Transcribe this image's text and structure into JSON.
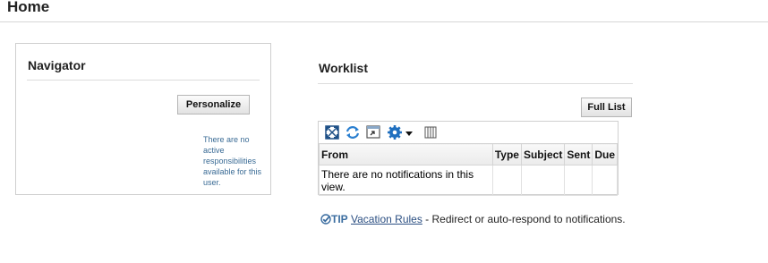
{
  "page": {
    "title": "Home"
  },
  "navigator": {
    "title": "Navigator",
    "personalize_label": "Personalize",
    "empty_message": "There are no active responsibilities available for this user."
  },
  "worklist": {
    "title": "Worklist",
    "full_list_label": "Full List",
    "toolbar_icons": [
      "expand-icon",
      "refresh-icon",
      "detach-icon",
      "settings-icon",
      "dropdown-arrow-icon",
      "columns-icon"
    ],
    "columns": [
      "From",
      "Type",
      "Subject",
      "Sent",
      "Due"
    ],
    "empty_message": "There are no notifications in this view."
  },
  "tip": {
    "label": "TIP",
    "link_text": "Vacation Rules",
    "text": " - Redirect or auto-respond to notifications."
  },
  "colors": {
    "accent": "#3b6da0",
    "link": "#2b4f82",
    "border": "#d0d0d0"
  }
}
